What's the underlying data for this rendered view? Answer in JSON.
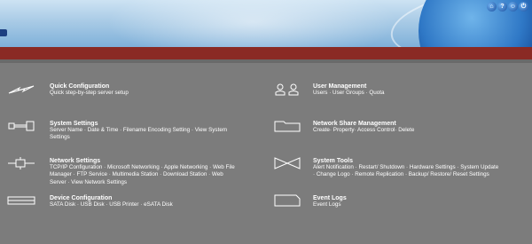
{
  "header": {
    "icons": [
      "home-icon",
      "help-icon",
      "user-icon",
      "logout-icon"
    ],
    "icon_glyphs": [
      "⌂",
      "?",
      "☺",
      "⏻"
    ]
  },
  "menu": [
    {
      "title": "Quick Configuration",
      "desc": "Quick step-by-step server setup"
    },
    {
      "title": "User Management",
      "desc": "Users · User Groups · Quota"
    },
    {
      "title": "System Settings",
      "desc": "Server Name · Date & Time · Filename Encoding Setting · View System Settings"
    },
    {
      "title": "Network Share Management",
      "desc": "Create· Property· Access Control· Delete"
    },
    {
      "title": "Network Settings",
      "desc": "TCP/IP Configuration · Microsoft Networking · Apple Networking · Web File Manager · FTP Service · Multimedia Station · Download Station · Web Server · View Network Settings"
    },
    {
      "title": "System Tools",
      "desc": "Alert Notification · Restart/ Shutdown · Hardware Settings · System Update · Change Logo · Remote Replication · Backup/ Restore/ Reset Settings"
    },
    {
      "title": "Device Configuration",
      "desc": "SATA Disk · USB Disk · USB Printer · eSATA Disk"
    },
    {
      "title": "Event Logs",
      "desc": "Event Logs"
    }
  ]
}
